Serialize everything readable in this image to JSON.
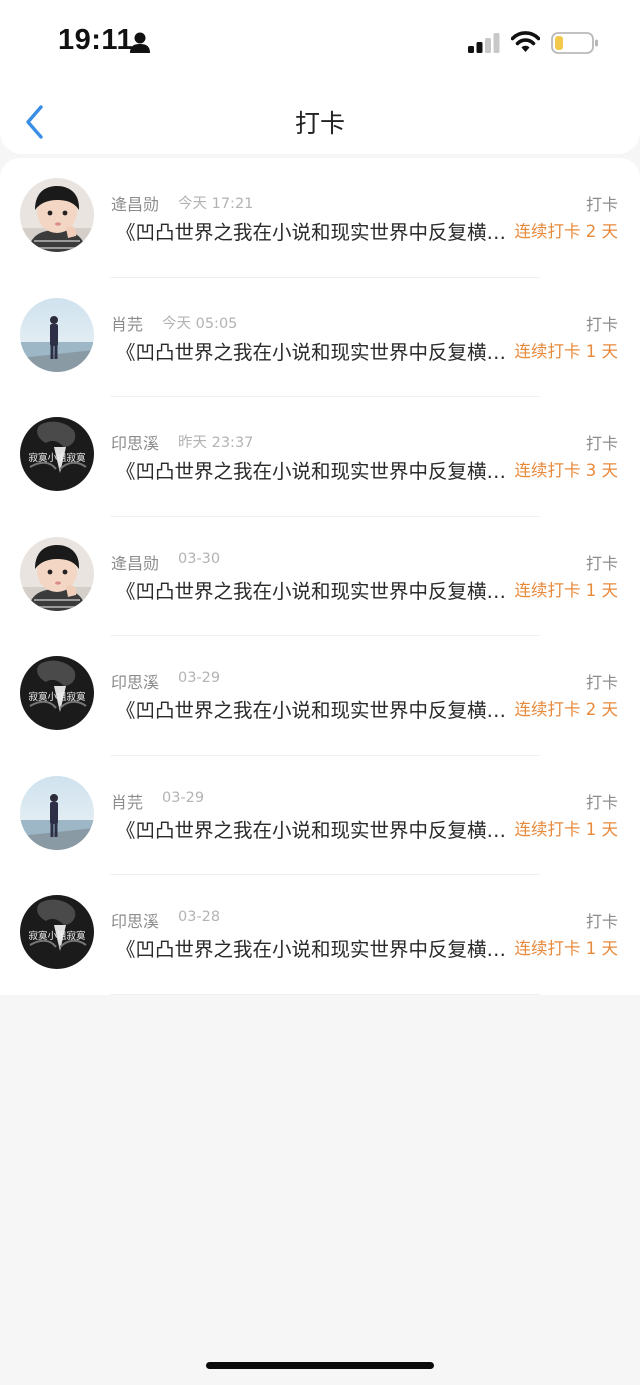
{
  "status_bar": {
    "time": "19:11"
  },
  "nav": {
    "title": "打卡"
  },
  "colors": {
    "accent_back": "#3a8ee6",
    "streak": "#e88a3c",
    "muted": "#8c8c8c",
    "time": "#b3b3b3"
  },
  "items": [
    {
      "name": "逄昌勋",
      "time": "今天 17:21",
      "type": "打卡",
      "title": "《凹凸世界之我在小说和现实世界中反复横跳》",
      "streak": "连续打卡 2 天",
      "avatar": "child-avatar"
    },
    {
      "name": "肖芫",
      "time": "今天 05:05",
      "type": "打卡",
      "title": "《凹凸世界之我在小说和现实世界中反复横跳》",
      "streak": "连续打卡 1 天",
      "avatar": "sea-figure-avatar"
    },
    {
      "name": "印思溪",
      "time": "昨天 23:37",
      "type": "打卡",
      "title": "《凹凸世界之我在小说和现实世界中反复横跳》",
      "streak": "连续打卡 3 天",
      "avatar": "dark-text-avatar"
    },
    {
      "name": "逄昌勋",
      "time": "03-30",
      "type": "打卡",
      "title": "《凹凸世界之我在小说和现实世界中反复横跳》",
      "streak": "连续打卡 1 天",
      "avatar": "child-avatar"
    },
    {
      "name": "印思溪",
      "time": "03-29",
      "type": "打卡",
      "title": "《凹凸世界之我在小说和现实世界中反复横跳》",
      "streak": "连续打卡 2 天",
      "avatar": "dark-text-avatar"
    },
    {
      "name": "肖芫",
      "time": "03-29",
      "type": "打卡",
      "title": "《凹凸世界之我在小说和现实世界中反复横跳》",
      "streak": "连续打卡 1 天",
      "avatar": "sea-figure-avatar"
    },
    {
      "name": "印思溪",
      "time": "03-28",
      "type": "打卡",
      "title": "《凹凸世界之我在小说和现实世界中反复横跳》",
      "streak": "连续打卡 1 天",
      "avatar": "dark-text-avatar"
    }
  ],
  "avatar_text": "寂寞小姐寂寞"
}
